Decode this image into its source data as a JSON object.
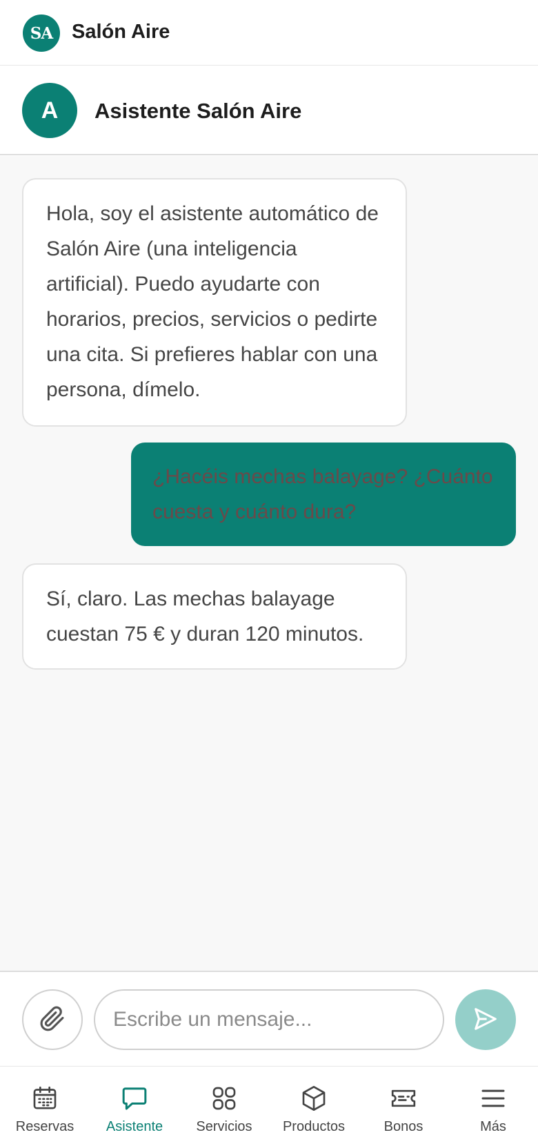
{
  "app": {
    "logo_text": "SA",
    "title": "Salón Aire"
  },
  "chat": {
    "avatar_letter": "A",
    "assistant_name": "Asistente Salón Aire",
    "messages": [
      {
        "sender": "assistant",
        "text": "Hola, soy el asistente automático de Salón Aire (una inteligencia artificial). Puedo ayudarte con horarios, precios, servicios o pedirte una cita. Si prefieres hablar con una persona, dímelo."
      },
      {
        "sender": "user",
        "text": "¿Hacéis mechas balayage? ¿Cuánto cuesta y cuánto dura?"
      },
      {
        "sender": "assistant",
        "text": "Sí, claro. Las mechas balayage cuestan 75 € y duran 120 minutos."
      }
    ]
  },
  "composer": {
    "attach_icon": "paperclip-icon",
    "placeholder": "Escribe un mensaje...",
    "value": "",
    "send_icon": "send-icon"
  },
  "nav": {
    "items": [
      {
        "label": "Reservas",
        "icon": "calendar-icon",
        "active": false
      },
      {
        "label": "Asistente",
        "icon": "chat-bubble-icon",
        "active": true
      },
      {
        "label": "Servicios",
        "icon": "grid-icon",
        "active": false
      },
      {
        "label": "Productos",
        "icon": "box-icon",
        "active": false
      },
      {
        "label": "Bonos",
        "icon": "ticket-icon",
        "active": false
      },
      {
        "label": "Más",
        "icon": "menu-icon",
        "active": false
      }
    ]
  },
  "colors": {
    "brand": "#0b8074",
    "send_button": "#94cfc9",
    "chat_background": "#f8f8f8",
    "user_bubble_text": "#6a4a4a"
  }
}
